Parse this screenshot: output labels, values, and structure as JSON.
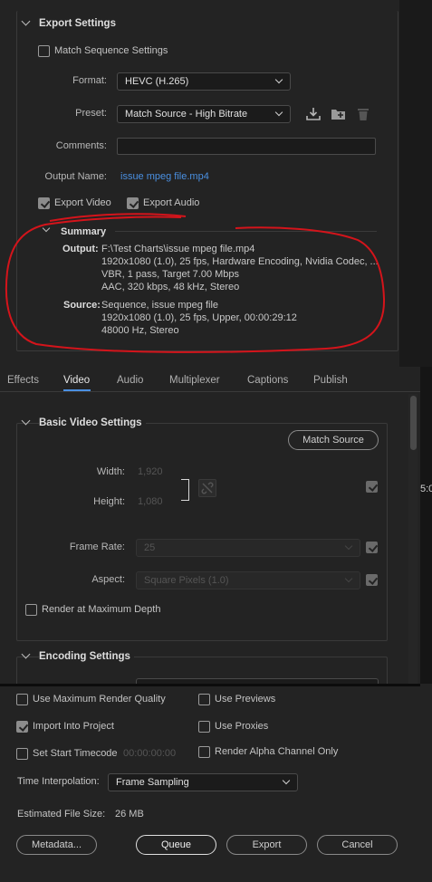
{
  "export_settings": {
    "title": "Export Settings",
    "match_sequence_label": "Match Sequence Settings",
    "match_sequence_checked": false,
    "format_label": "Format:",
    "format_value": "HEVC (H.265)",
    "preset_label": "Preset:",
    "preset_value": "Match Source - High Bitrate",
    "comments_label": "Comments:",
    "comments_value": "",
    "output_name_label": "Output Name:",
    "output_name_value": "issue mpeg file.mp4",
    "export_video_label": "Export Video",
    "export_video_checked": true,
    "export_audio_label": "Export Audio",
    "export_audio_checked": true
  },
  "summary": {
    "title": "Summary",
    "output_key": "Output:",
    "output_lines": [
      "F:\\Test Charts\\issue mpeg file.mp4",
      "1920x1080 (1.0), 25 fps, Hardware Encoding, Nvidia Codec, ...",
      "VBR, 1 pass, Target 7.00 Mbps",
      "AAC, 320 kbps, 48 kHz, Stereo"
    ],
    "source_key": "Source:",
    "source_lines": [
      "Sequence, issue mpeg file",
      "1920x1080 (1.0), 25 fps, Upper, 00:00:29:12",
      "48000 Hz, Stereo"
    ]
  },
  "tabs": [
    "Effects",
    "Video",
    "Audio",
    "Multiplexer",
    "Captions",
    "Publish"
  ],
  "active_tab": "Video",
  "basic_video": {
    "title": "Basic Video Settings",
    "match_source_label": "Match Source",
    "width_label": "Width:",
    "width_value": "1,920",
    "height_label": "Height:",
    "height_value": "1,080",
    "frame_rate_label": "Frame Rate:",
    "frame_rate_value": "25",
    "aspect_label": "Aspect:",
    "aspect_value": "Square Pixels (1.0)",
    "render_max_depth_label": "Render at Maximum Depth"
  },
  "encoding": {
    "title": "Encoding Settings"
  },
  "bottom": {
    "use_max_render_quality": "Use Maximum Render Quality",
    "use_previews": "Use Previews",
    "import_into_project": "Import Into Project",
    "use_proxies": "Use Proxies",
    "set_start_timecode": "Set Start Timecode",
    "start_timecode_value": "00:00:00:00",
    "render_alpha_only": "Render Alpha Channel Only",
    "time_interpolation_label": "Time Interpolation:",
    "time_interpolation_value": "Frame Sampling",
    "estimated_size_label": "Estimated File Size:",
    "estimated_size_value": "26 MB"
  },
  "buttons": {
    "metadata": "Metadata...",
    "queue": "Queue",
    "export": "Export",
    "cancel": "Cancel"
  },
  "right_edge_text": "5:0",
  "colors": {
    "accent_link": "#4a90e2",
    "annotation_red": "#d4141b",
    "background": "#232323"
  }
}
